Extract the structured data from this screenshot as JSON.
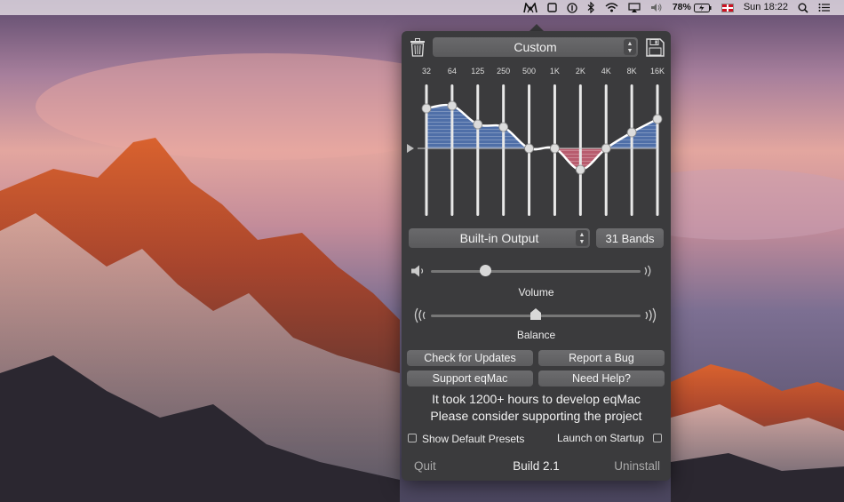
{
  "menubar": {
    "app_icon": "eqmac-logo-icon",
    "battery": "78%",
    "language_flag": "uk-flag-icon",
    "clock": "Sun 18:22",
    "icons": [
      "stop-icon",
      "info-icon",
      "bluetooth-icon",
      "wifi-icon",
      "airplay-icon",
      "volume-icon",
      "battery-icon",
      "search-icon",
      "menu-list-icon"
    ]
  },
  "eq": {
    "delete_icon": "trash-icon",
    "save_icon": "save-icon",
    "preset": "Custom",
    "bands": [
      "32",
      "64",
      "125",
      "250",
      "500",
      "1K",
      "2K",
      "4K",
      "8K",
      "16K"
    ],
    "band_levels": [
      0.75,
      0.8,
      0.45,
      0.4,
      0.0,
      0.0,
      -0.4,
      0.0,
      0.3,
      0.55
    ],
    "colors": {
      "boost": "#4f6fa8",
      "cut": "#b85c6e",
      "curve": "#ffffff"
    }
  },
  "output": {
    "device": "Built-in Output",
    "band_mode": "31 Bands"
  },
  "volume": {
    "label": "Volume",
    "level": 0.26
  },
  "balance": {
    "label": "Balance",
    "level": 0.5
  },
  "buttons": {
    "check_updates": "Check for Updates",
    "report_bug": "Report a Bug",
    "support": "Support eqMac",
    "need_help": "Need Help?"
  },
  "message": {
    "line1": "It took 1200+ hours to develop eqMac",
    "line2": "Please consider supporting the project"
  },
  "options": {
    "show_default_presets": "Show Default Presets",
    "launch_on_startup": "Launch on Startup"
  },
  "footer": {
    "quit": "Quit",
    "build": "Build 2.1",
    "uninstall": "Uninstall"
  }
}
